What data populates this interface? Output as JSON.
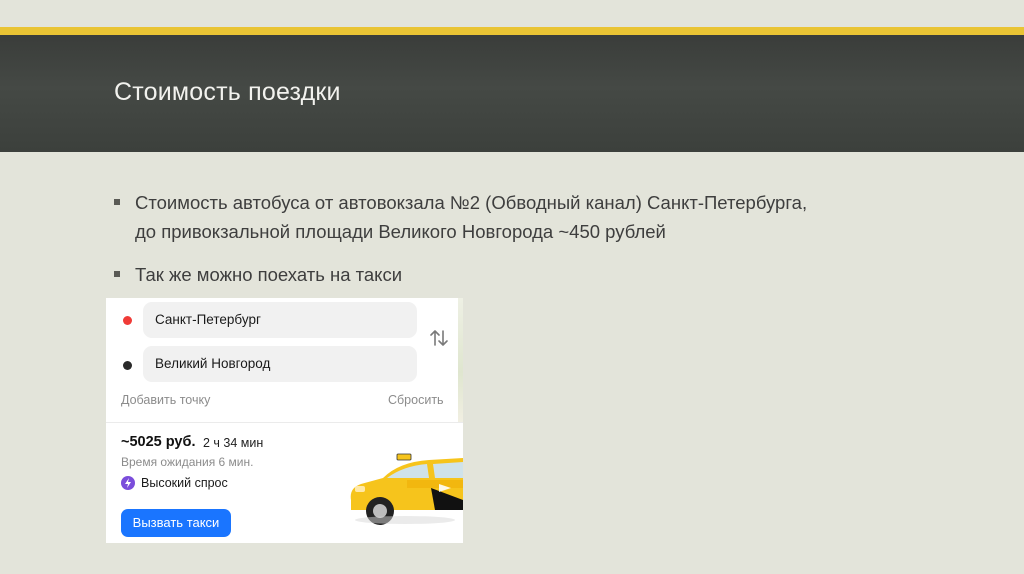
{
  "slide": {
    "title": "Стоимость поездки",
    "accent_color": "#e9c434",
    "header_color": "#404440",
    "bullets": [
      {
        "line1": "Стоимость автобуса от автовокзала №2 (Обводный канал) Санкт-Петербурга,",
        "line2": "до привокзальной площади Великого Новгорода  ~450 рублей"
      },
      {
        "line1": "Так же можно поехать на такси"
      }
    ]
  },
  "taxi_app": {
    "route": {
      "from": "Санкт-Петербург",
      "to": "Великий Новгород",
      "from_dot_color": "#f03b37",
      "to_dot_color": "#2a2a2a"
    },
    "swap_icon": "swap-vertical-arrows-icon",
    "add_point_label": "Добавить точку",
    "reset_label": "Сбросить",
    "price": "~5025 руб.",
    "duration": "2 ч 34 мин",
    "wait_time": "Время ожидания 6 мин.",
    "demand_label": "Высокий спрос",
    "demand_icon": "lightning-icon",
    "call_button_label": "Вызвать такси",
    "button_color": "#1a75ff",
    "car_image": "yellow-taxi-car-image"
  }
}
